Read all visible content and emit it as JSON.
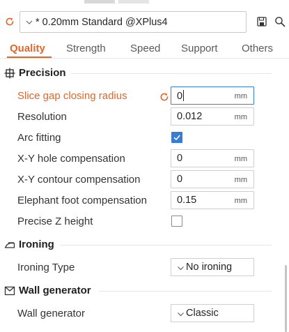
{
  "toolbar": {
    "preset": "* 0.20mm Standard @XPlus4"
  },
  "tabs": [
    {
      "label": "Quality",
      "active": true
    },
    {
      "label": "Strength",
      "active": false
    },
    {
      "label": "Speed",
      "active": false
    },
    {
      "label": "Support",
      "active": false
    },
    {
      "label": "Others",
      "active": false
    }
  ],
  "colors": {
    "accent": "#e0672b",
    "checkbox_checked": "#3a7bd5",
    "focus_border": "#3b7fcf"
  },
  "sections": {
    "precision": {
      "title": "Precision",
      "icon": "precision-icon",
      "rows": {
        "slice_gap": {
          "label": "Slice gap closing radius",
          "value": "0",
          "unit": "mm",
          "modified": true,
          "focused": true
        },
        "resolution": {
          "label": "Resolution",
          "value": "0.012",
          "unit": "mm"
        },
        "arc_fitting": {
          "label": "Arc fitting",
          "checked": true
        },
        "xy_hole": {
          "label": "X-Y hole compensation",
          "value": "0",
          "unit": "mm"
        },
        "xy_contour": {
          "label": "X-Y contour compensation",
          "value": "0",
          "unit": "mm"
        },
        "elephant_foot": {
          "label": "Elephant foot compensation",
          "value": "0.15",
          "unit": "mm"
        },
        "precise_z": {
          "label": "Precise Z height",
          "checked": false
        }
      }
    },
    "ironing": {
      "title": "Ironing",
      "icon": "ironing-icon",
      "rows": {
        "ironing_type": {
          "label": "Ironing Type",
          "value": "No ironing"
        }
      }
    },
    "wall_generator": {
      "title": "Wall generator",
      "icon": "wall-generator-icon",
      "rows": {
        "wall_generator": {
          "label": "Wall generator",
          "value": "Classic"
        }
      }
    }
  }
}
